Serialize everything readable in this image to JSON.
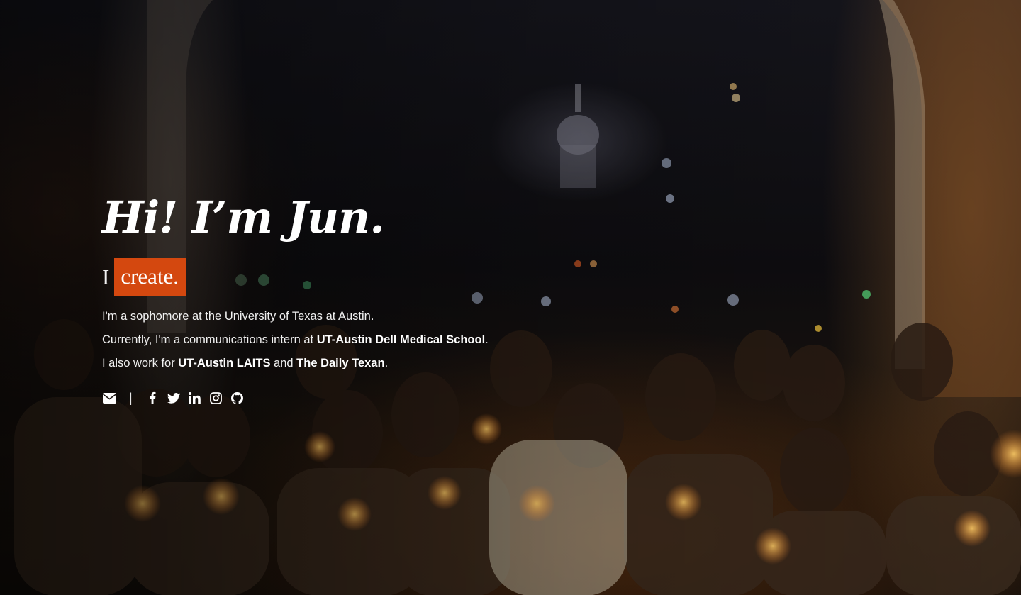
{
  "hero": {
    "headline": "Hi! I’m Jun.",
    "tagline_prefix": "I",
    "tagline_highlight": "create.",
    "bio": {
      "line1": "I'm a sophomore at the University of Texas at Austin.",
      "line2_prefix": "Currently, I'm a communications intern at ",
      "line2_link": "UT-Austin Dell Medical School",
      "line2_suffix": ".",
      "line3_prefix": "I also work for ",
      "line3_link1": "UT-Austin LAITS",
      "line3_middle": " and ",
      "line3_link2": "The Daily Texan",
      "line3_suffix": "."
    },
    "social": {
      "separator": "|",
      "icons": [
        "envelope-icon",
        "facebook-icon",
        "twitter-icon",
        "linkedin-icon",
        "instagram-icon",
        "github-icon"
      ]
    }
  },
  "colors": {
    "accent": "#d4480f",
    "text": "#ffffff"
  }
}
